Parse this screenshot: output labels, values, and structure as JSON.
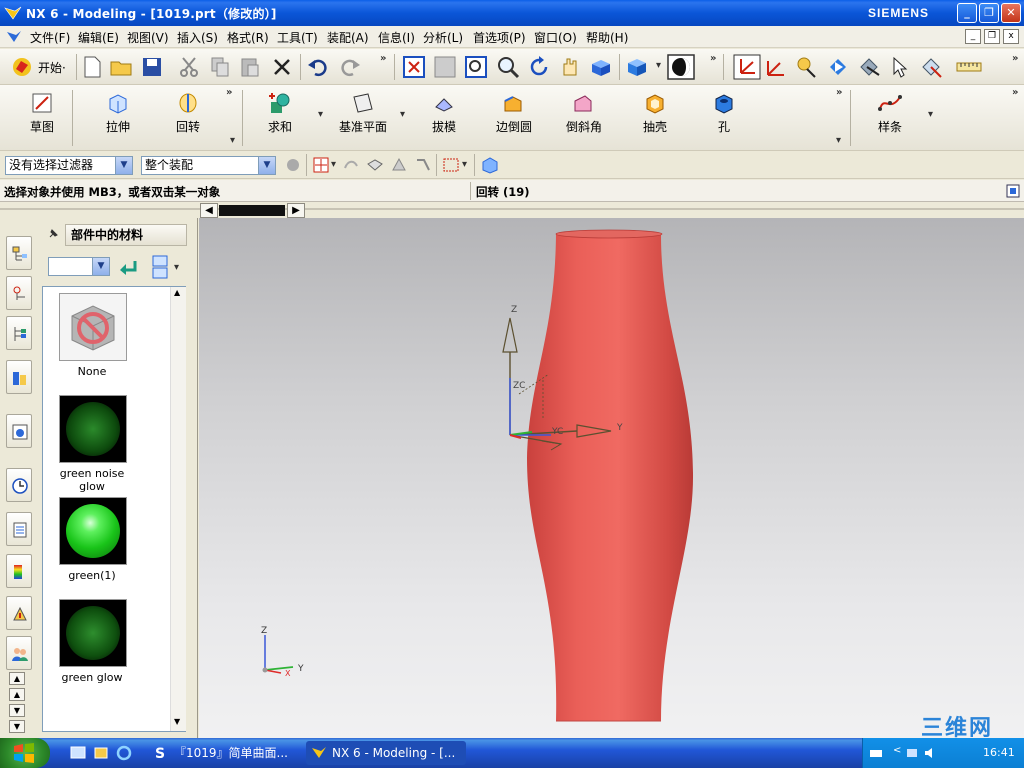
{
  "window": {
    "title": "NX 6 - Modeling - [1019.prt（修改的）]",
    "brand": "SIEMENS",
    "btn_min": "_",
    "btn_max": "❐",
    "btn_close": "✕"
  },
  "menubar": {
    "items": [
      "文件(F)",
      "编辑(E)",
      "视图(V)",
      "插入(S)",
      "格式(R)",
      "工具(T)",
      "装配(A)",
      "信息(I)",
      "分析(L)",
      "首选项(P)",
      "窗口(O)",
      "帮助(H)"
    ],
    "doc_min": "_",
    "doc_restore": "❐",
    "doc_close": "x"
  },
  "standard_toolbar": {
    "start_label": "开始·"
  },
  "feature_toolbar": {
    "sketch": "草图",
    "extrude": "拉伸",
    "revolve": "回转",
    "unite": "求和",
    "datum_plane": "基准平面",
    "draft": "拔模",
    "edge_blend": "边倒圆",
    "chamfer": "倒斜角",
    "shell": "抽壳",
    "hole": "孔",
    "spline": "样条"
  },
  "selection_bar": {
    "filter_value": "没有选择过滤器",
    "scope_value": "整个装配"
  },
  "status": {
    "prompt": "选择对象并使用 MB3，或者双击某一对象",
    "feature": "回转 (19)"
  },
  "materials_panel": {
    "title": "部件中的材料",
    "items": [
      {
        "name": "None"
      },
      {
        "name": "green noise glow"
      },
      {
        "name": "green(1)"
      },
      {
        "name": "green glow"
      }
    ]
  },
  "triad": {
    "wcs_z": "Z",
    "wcs_zc": "ZC",
    "wcs_yc": "YC",
    "wcs_y": "Y",
    "abs_z": "Z",
    "abs_y": "Y",
    "abs_x": "X"
  },
  "colors": {
    "model": "#e0544c",
    "title_bar": "#0a56d8",
    "taskbar": "#2157d7"
  },
  "taskbar": {
    "items": [
      "『1019』简单曲面...",
      "NX 6 - Modeling - [..."
    ],
    "clock": "16:41",
    "watermark": "三维网"
  }
}
